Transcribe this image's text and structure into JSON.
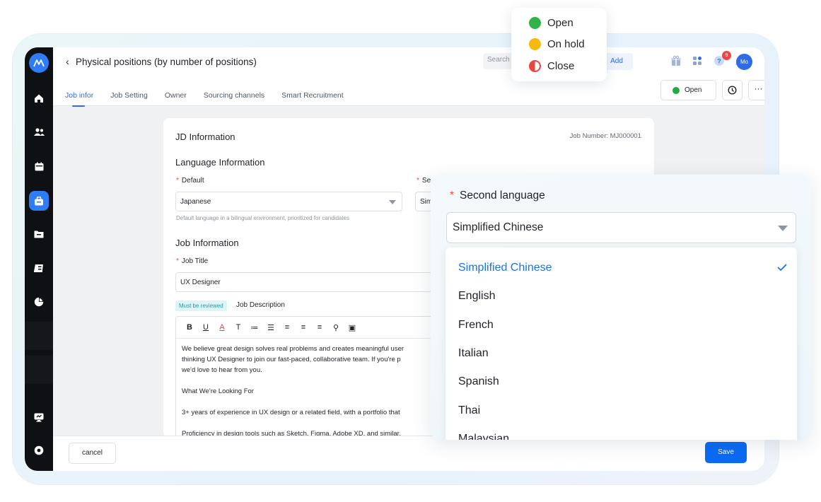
{
  "header": {
    "back_glyph": "‹",
    "title": "Physical positions (by number of positions)",
    "search_placeholder": "Search",
    "add_label": "Add",
    "notification_count": "9",
    "avatar_initials": "Mo"
  },
  "tabs": [
    {
      "label": "Job infor"
    },
    {
      "label": "Job Setting"
    },
    {
      "label": "Owner"
    },
    {
      "label": "Sourcing channels"
    },
    {
      "label": "Smart Recruitment"
    }
  ],
  "status_button": {
    "label": "Open",
    "color": "#1fad3c"
  },
  "more_label": "···",
  "card": {
    "title": "JD Information",
    "job_number": "Job Number: MJ000001",
    "language_section": "Language Information",
    "default_label": "Default",
    "default_value": "Japanese",
    "second_label_partial": "Se",
    "second_value_partial": "Sim",
    "default_hint": "Default language in a bilingual environment, prioritized for candidates",
    "job_section": "Job Information",
    "job_title_label": "Job Title",
    "job_title_value": "UX Designer",
    "review_badge": "Must be reviewed",
    "description_label": "Job Description",
    "toolbar": [
      "B",
      "U",
      "A",
      "T",
      "≔",
      "☰",
      "≡",
      "≡",
      "≡",
      "⚲",
      "▣"
    ],
    "description_lines": [
      "We believe great design solves real problems and creates meaningful user",
      "thinking UX Designer to join our fast-paced, collaborative team. If you're p",
      "we'd love to hear from you.",
      "What We're Looking For",
      "3+ years of experience in UX design or a related field, with a portfolio that",
      "Proficiency in design tools such as Sketch, Figma, Adobe XD, and similar."
    ]
  },
  "footer": {
    "cancel_label": "cancel",
    "save_label": "Save"
  },
  "status_popup": {
    "options": [
      {
        "label": "Open",
        "color": "#2fb34a"
      },
      {
        "label": "On hold",
        "color": "#f5b90f"
      },
      {
        "label": "Close",
        "color": "#e8473f"
      }
    ]
  },
  "language_dropdown": {
    "label": "Second language",
    "selected": "Simplified Chinese",
    "options": [
      "Simplified Chinese",
      "English",
      "French",
      "Italian",
      "Spanish",
      "Thai",
      "Malaysian"
    ],
    "accent": "#1a73e8"
  },
  "rail_icons": [
    "home-icon",
    "people-icon",
    "calendar-icon",
    "briefcase-icon",
    "folder-icon",
    "contacts-icon",
    "pie-chart-icon",
    "monitor-icon",
    "settings-icon"
  ]
}
